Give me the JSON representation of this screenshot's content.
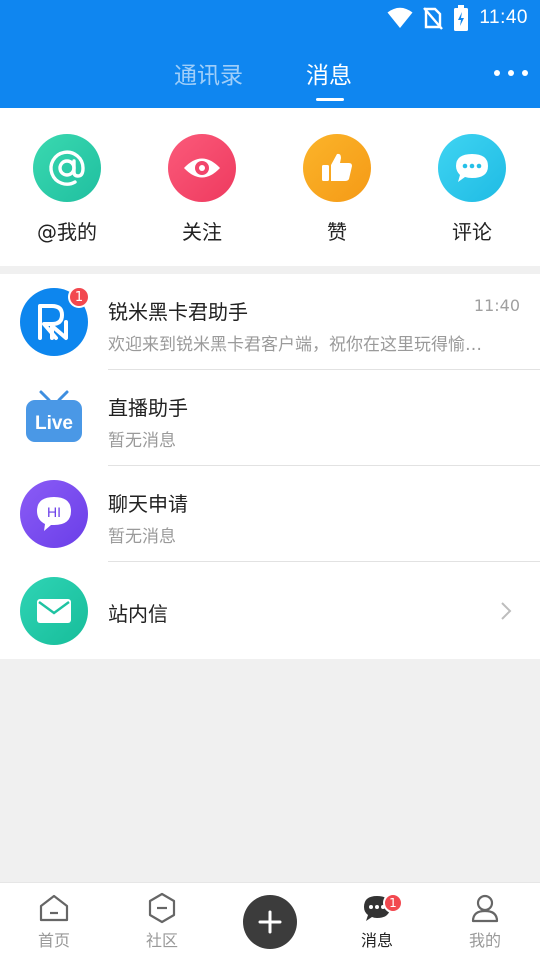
{
  "status_bar": {
    "time": "11:40"
  },
  "header": {
    "tabs": [
      {
        "label": "通讯录",
        "active": false
      },
      {
        "label": "消息",
        "active": true
      }
    ]
  },
  "quick_actions": [
    {
      "label": "@我的",
      "icon": "at-icon",
      "color": "#2fcfaa"
    },
    {
      "label": "关注",
      "icon": "eye-icon",
      "color": "#f5456b"
    },
    {
      "label": "赞",
      "icon": "thumbs-up-icon",
      "color": "#f8a21f"
    },
    {
      "label": "评论",
      "icon": "comment-icon",
      "color": "#2fc8ee"
    }
  ],
  "messages": [
    {
      "title": "锐米黑卡君助手",
      "subtitle": "欢迎来到锐米黑卡君客户端，祝你在这里玩得愉快！",
      "time": "11:40",
      "badge": "1",
      "icon": "rn-logo-icon"
    },
    {
      "title": "直播助手",
      "subtitle": "暂无消息",
      "icon": "live-tv-icon",
      "avatar_text": "Live"
    },
    {
      "title": "聊天申请",
      "subtitle": "暂无消息",
      "icon": "hi-chat-icon",
      "avatar_text": "HI"
    },
    {
      "title": "站内信",
      "icon": "mail-icon"
    }
  ],
  "bottom_nav": [
    {
      "label": "首页",
      "icon": "home-icon"
    },
    {
      "label": "社区",
      "icon": "community-icon"
    },
    {
      "label": "",
      "icon": "plus-icon"
    },
    {
      "label": "消息",
      "icon": "message-icon",
      "badge": "1",
      "active": true
    },
    {
      "label": "我的",
      "icon": "profile-icon"
    }
  ],
  "colors": {
    "brand": "#0f86f0",
    "badge": "#f2484f"
  }
}
